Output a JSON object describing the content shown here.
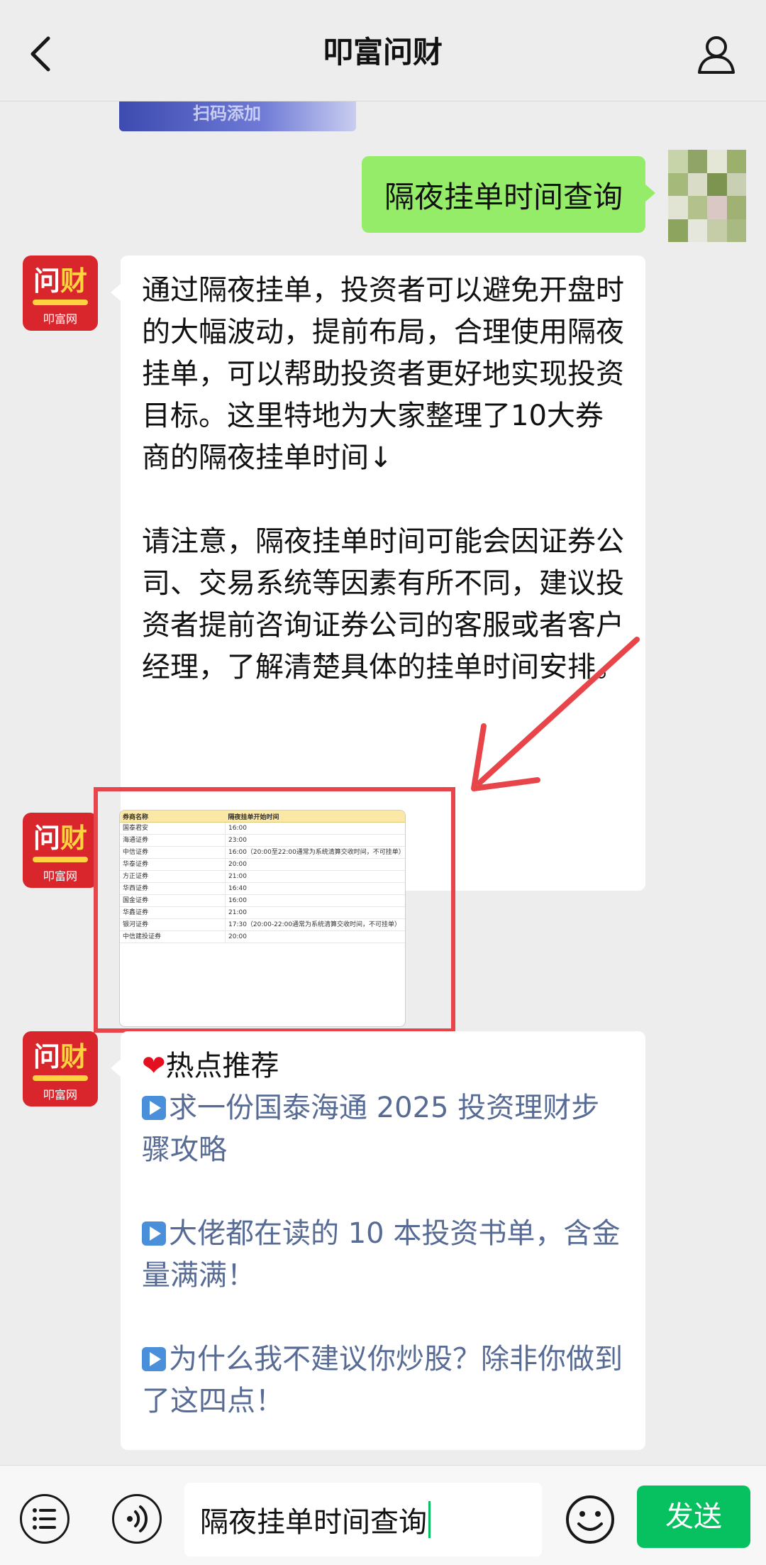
{
  "header": {
    "title": "叩富问财"
  },
  "chat": {
    "partial_image_text": "扫码添加",
    "user_message": "隔夜挂单时间查询",
    "bot_message_1": {
      "paragraph_1": "通过隔夜挂单，投资者可以避免开盘时的大幅波动，提前布局，合理使用隔夜挂单，可以帮助投资者更好地实现投资目标。这里特地为大家整理了10大券商的隔夜挂单时间↓",
      "paragraph_2": "请注意，隔夜挂单时间可能会因证券公司、交易系统等因素有所不同，建议投资者提前咨询证券公司的客服或者客户经理，了解清楚具体的挂单时间安排。"
    },
    "table_image": {
      "headers": [
        "券商名称",
        "隔夜挂单开始时间"
      ],
      "rows": [
        [
          "国泰君安",
          "16:00"
        ],
        [
          "海通证券",
          "23:00"
        ],
        [
          "中信证券",
          "16:00（20:00至22:00通常为系统清算交收时间，不可挂单）"
        ],
        [
          "华泰证券",
          "20:00"
        ],
        [
          "方正证券",
          "21:00"
        ],
        [
          "华西证券",
          "16:40"
        ],
        [
          "国金证券",
          "16:00"
        ],
        [
          "华鑫证券",
          "21:00"
        ],
        [
          "银河证券",
          "17:30（20:00-22:00通常为系统清算交收时间，不可挂单）"
        ],
        [
          "中信建投证券",
          "20:00"
        ]
      ]
    },
    "bot_message_3": {
      "hot_title": "热点推荐",
      "links": [
        "求一份国泰海通 2025 投资理财步骤攻略",
        "大佬都在读的 10 本投资书单，含金量满满！",
        "为什么我不建议你炒股？除非你做到了这四点！"
      ]
    },
    "bot_avatar": {
      "line1_a": "问",
      "line1_b": "财",
      "line2": "叩富网"
    }
  },
  "input_bar": {
    "input_value": "隔夜挂单时间查询",
    "send_label": "发送"
  },
  "icons": {
    "back": "chevron-left-icon",
    "profile": "person-icon",
    "menu": "list-icon",
    "voice": "voice-icon",
    "emoji": "emoji-icon"
  },
  "colors": {
    "user_bubble": "#95ec69",
    "send_button": "#07c160",
    "link": "#576b95",
    "highlight": "#e8454b"
  }
}
